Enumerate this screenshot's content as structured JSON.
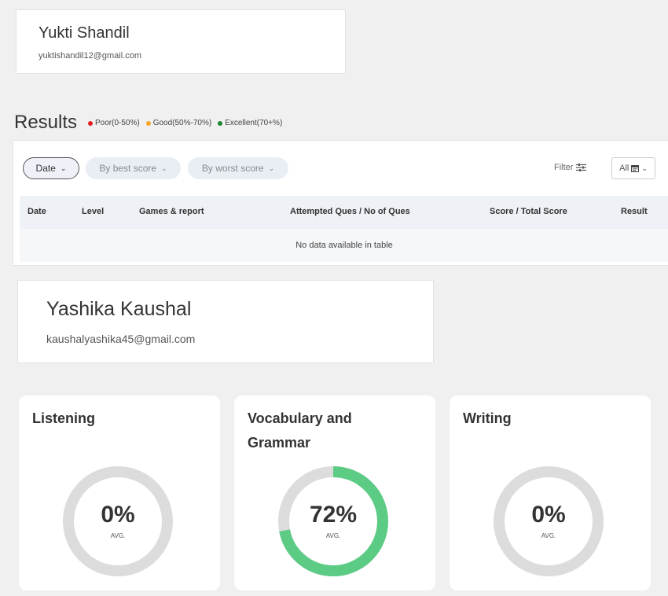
{
  "user1": {
    "name": "Yukti Shandil",
    "email": "yuktishandil12@gmail.com"
  },
  "results": {
    "title": "Results",
    "legend": [
      {
        "label": "Poor(0-50%)",
        "color": "#e02020"
      },
      {
        "label": "Good(50%-70%)",
        "color": "#f5a623"
      },
      {
        "label": "Excellent(70+%)",
        "color": "#1e8a2e"
      }
    ],
    "sort_pills": [
      {
        "label": "Date"
      },
      {
        "label": "By best score"
      },
      {
        "label": "By worst score"
      }
    ],
    "filter_label": "Filter",
    "filter_icon": "sliders-icon",
    "range_select": {
      "value": "All",
      "icon": "calendar-icon"
    },
    "columns": [
      "Date",
      "Level",
      "Games & report",
      "Attempted Ques / No of Ques",
      "Score / Total Score",
      "Result"
    ],
    "empty_message": "No data available in table"
  },
  "user2": {
    "name": "Yashika Kaushal",
    "email": "kaushalyashika45@gmail.com"
  },
  "skills": [
    {
      "title": "Listening",
      "percent": 0,
      "percent_text": "0%",
      "avg_label": "AVG."
    },
    {
      "title": "Vocabulary and Grammar",
      "percent": 72,
      "percent_text": "72%",
      "avg_label": "AVG."
    },
    {
      "title": "Writing",
      "percent": 0,
      "percent_text": "0%",
      "avg_label": "AVG."
    }
  ],
  "colors": {
    "gauge_fill": "#5ccb84",
    "gauge_track": "#dcdcdc"
  }
}
